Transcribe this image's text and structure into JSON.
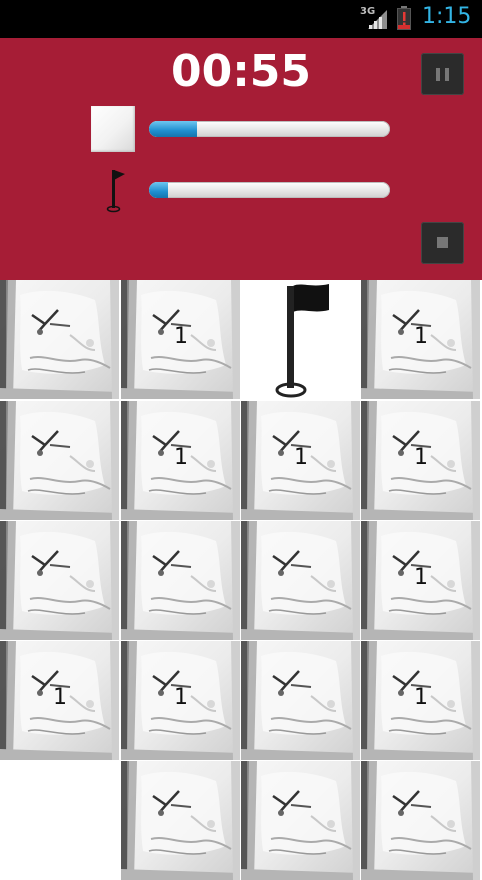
{
  "status_bar": {
    "network": "3G",
    "time": "1:15"
  },
  "header": {
    "timer": "00:55",
    "time_progress": 0.2,
    "flag_progress": 0.08,
    "pause_icon": "pause-icon",
    "stop_icon": "stop-icon"
  },
  "colors": {
    "header_bg": "#a61d36",
    "progress_fill": "#1f8fd0",
    "status_time": "#33b5e5"
  },
  "board": {
    "rows": [
      [
        "",
        "1",
        "flag",
        "1"
      ],
      [
        "",
        "1",
        "1",
        "1"
      ],
      [
        "",
        "",
        "",
        "1"
      ],
      [
        "1",
        "1",
        "",
        "1"
      ],
      [
        "empty",
        "",
        "",
        ""
      ]
    ]
  }
}
